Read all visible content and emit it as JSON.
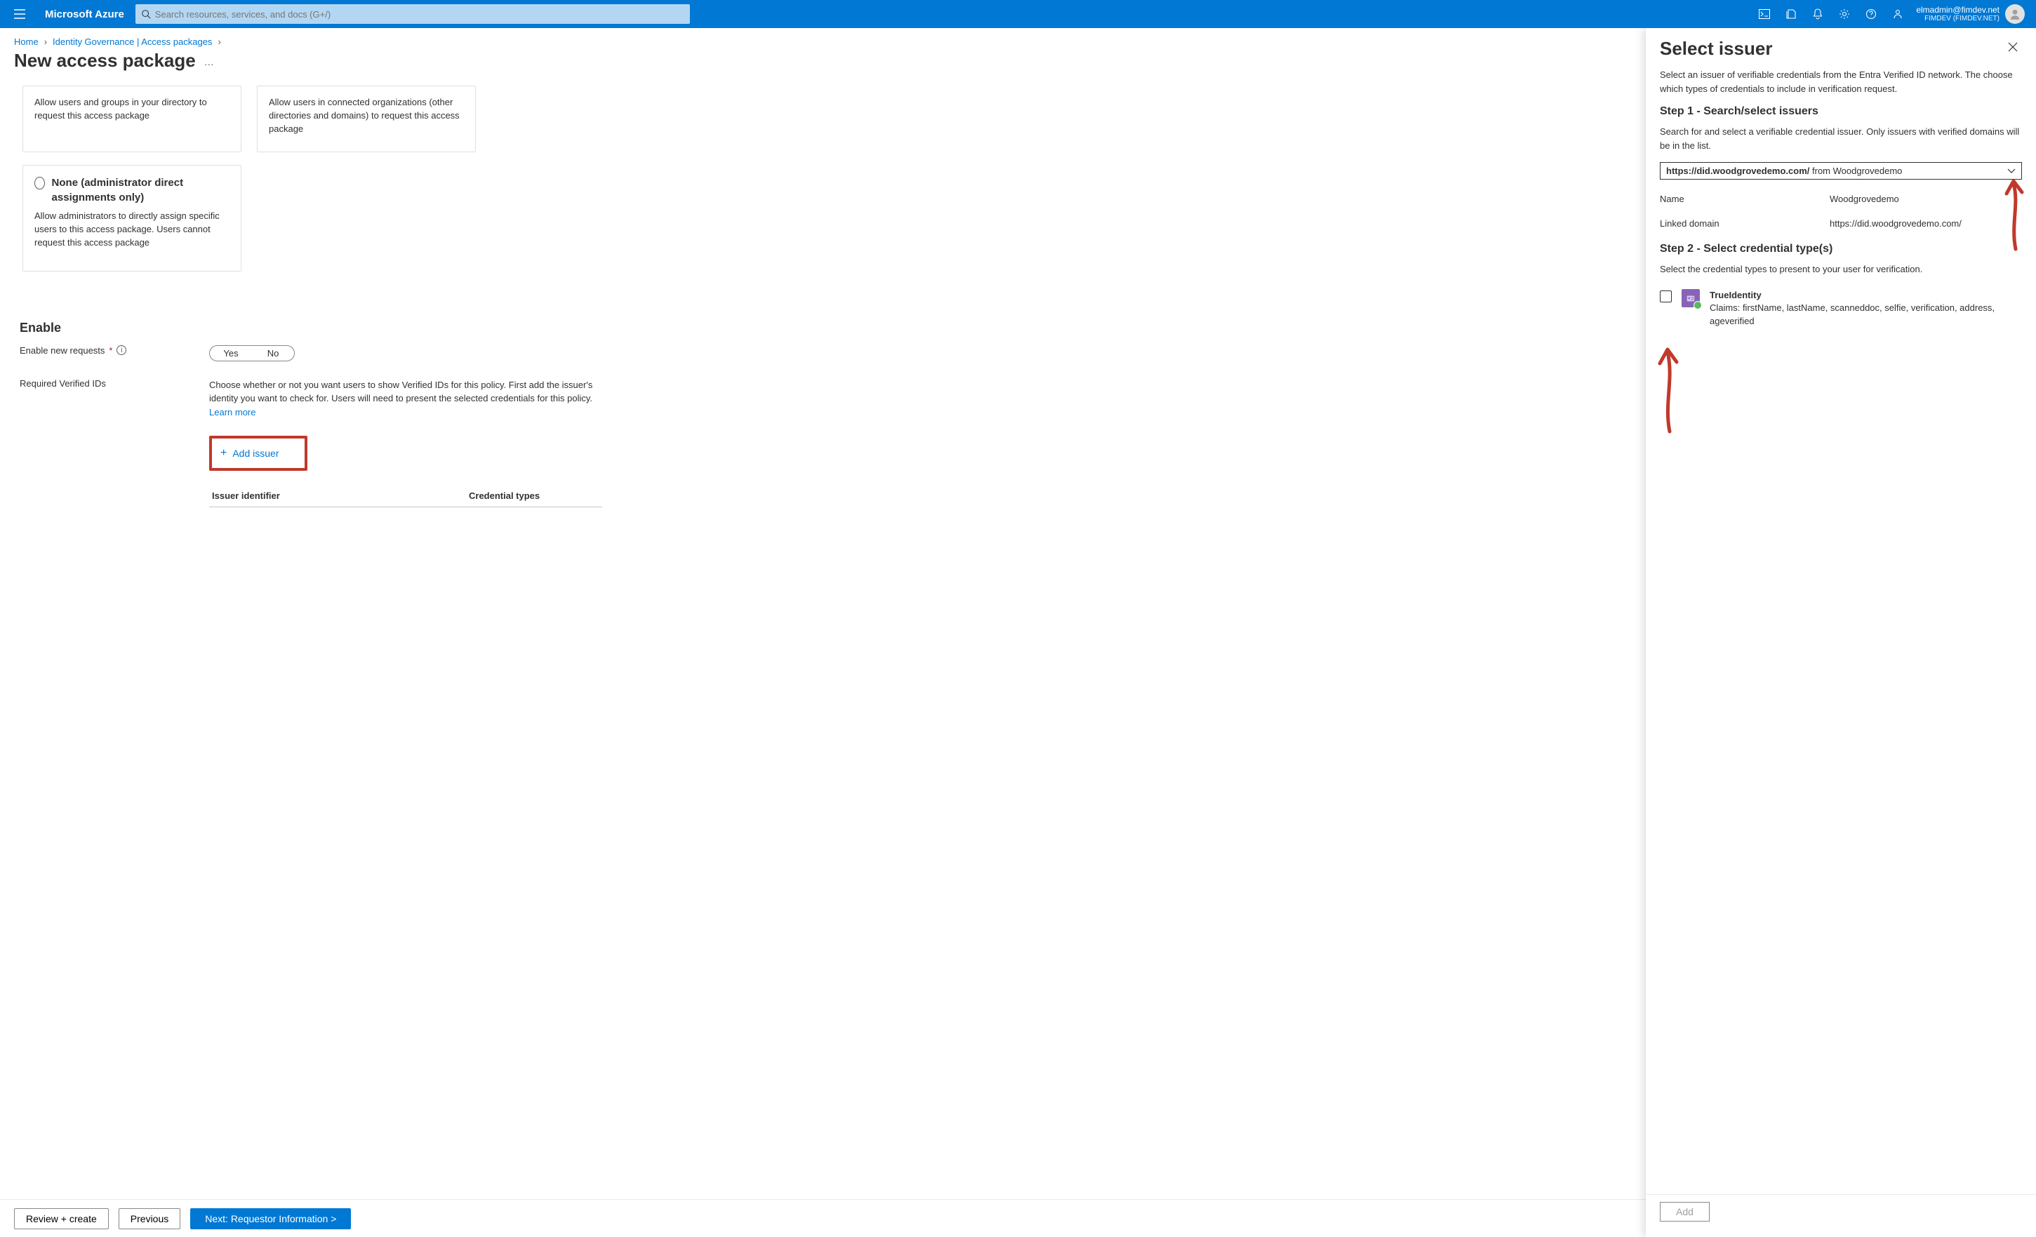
{
  "topbar": {
    "brand": "Microsoft Azure",
    "searchPlaceholder": "Search resources, services, and docs (G+/)",
    "accountEmail": "elmadmin@fimdev.net",
    "accountTenant": "FIMDEV (FIMDEV.NET)"
  },
  "breadcrumbs": {
    "home": "Home",
    "identityGov": "Identity Governance | Access packages"
  },
  "pageTitle": "New access package",
  "cards": {
    "c1_body": "Allow users and groups in your directory to request this access package",
    "c2_body": "Allow users in connected organizations (other directories and domains) to request this access package",
    "c3_title": "None (administrator direct assignments only)",
    "c3_body": "Allow administrators to directly assign specific users to this access package. Users cannot request this access package"
  },
  "section": {
    "heading": "Enable",
    "enableLabel": "Enable new requests",
    "yes": "Yes",
    "no": "No",
    "verifiedIdsLabel": "Required Verified IDs",
    "verifiedIdsDesc": "Choose whether or not you want users to show Verified IDs for this policy. First add the issuer's identity you want to check for. Users will need to present the selected credentials for this policy. ",
    "learnMore": "Learn more",
    "addIssuer": "Add issuer",
    "tableCol1": "Issuer identifier",
    "tableCol2": "Credential types"
  },
  "buttons": {
    "review": "Review + create",
    "previous": "Previous",
    "next": "Next: Requestor Information >"
  },
  "flyout": {
    "title": "Select issuer",
    "intro": "Select an issuer of verifiable credentials from the Entra Verified ID network. The choose which types of credentials to include in verification request.",
    "step1": "Step 1 - Search/select issuers",
    "step1desc": "Search for and select a verifiable credential issuer. Only issuers with verified domains will be in the list.",
    "dropdownBold": "https://did.woodgrovedemo.com/",
    "dropdownRest": " from  Woodgrovedemo",
    "nameLabel": "Name",
    "nameValue": "Woodgrovedemo",
    "linkedDomainLabel": "Linked domain",
    "linkedDomainValue": "https://did.woodgrovedemo.com/",
    "step2": "Step 2 - Select credential type(s)",
    "step2desc": "Select the credential types to present to your user for verification.",
    "credTitle": "TrueIdentity",
    "credClaims": "Claims: firstName, lastName, scanneddoc, selfie, verification, address, ageverified",
    "add": "Add"
  }
}
